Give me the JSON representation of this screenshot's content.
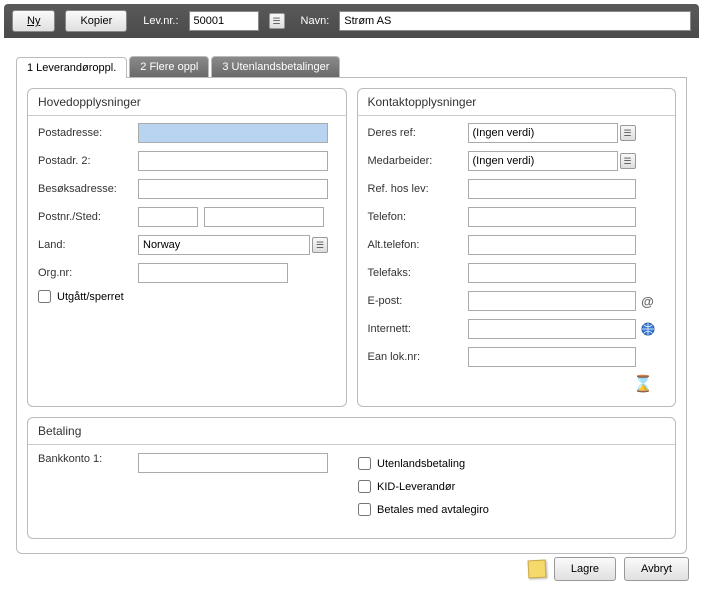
{
  "topbar": {
    "ny_label": "Ny",
    "kopier_label": "Kopier",
    "levnr_label": "Lev.nr.:",
    "levnr_value": "50001",
    "navn_label": "Navn:",
    "navn_value": "Strøm AS"
  },
  "tabs": {
    "t1": "1 Leverandøroppl.",
    "t2": "2 Flere oppl",
    "t3": "3 Utenlandsbetalinger"
  },
  "hoved": {
    "header": "Hovedopplysninger",
    "postadresse": "Postadresse:",
    "postadr2": "Postadr. 2:",
    "besoks": "Besøksadresse:",
    "postnr": "Postnr./Sted:",
    "land": "Land:",
    "land_value": "Norway",
    "orgnr": "Org.nr:",
    "utgatt": "Utgått/sperret"
  },
  "kontakt": {
    "header": "Kontaktopplysninger",
    "deres_ref": "Deres ref:",
    "deres_ref_value": "(Ingen verdi)",
    "medarbeider": "Medarbeider:",
    "medarbeider_value": "(Ingen verdi)",
    "ref_hos_lev": "Ref. hos lev:",
    "telefon": "Telefon:",
    "alt_telefon": "Alt.telefon:",
    "telefaks": "Telefaks:",
    "epost": "E-post:",
    "internett": "Internett:",
    "ean": "Ean lok.nr:"
  },
  "betaling": {
    "header": "Betaling",
    "bankkonto1": "Bankkonto 1:",
    "utenlands": "Utenlandsbetaling",
    "kid": "KID-Leverandør",
    "avtalegiro": "Betales med avtalegiro"
  },
  "footer": {
    "lagre": "Lagre",
    "avbryt": "Avbryt"
  }
}
